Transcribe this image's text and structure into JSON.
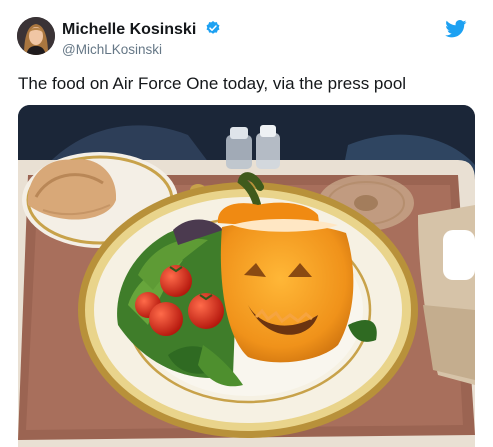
{
  "tweet": {
    "author_name": "Michelle Kosinski",
    "author_handle": "@MichLKosinski",
    "text": "The food on Air Force One today, via the press pool",
    "verified_icon": "verified-badge-icon",
    "brand_icon": "twitter-bird-icon"
  },
  "colors": {
    "text": "#14171a",
    "handle": "#657786",
    "twitter_blue": "#1da1f2"
  }
}
